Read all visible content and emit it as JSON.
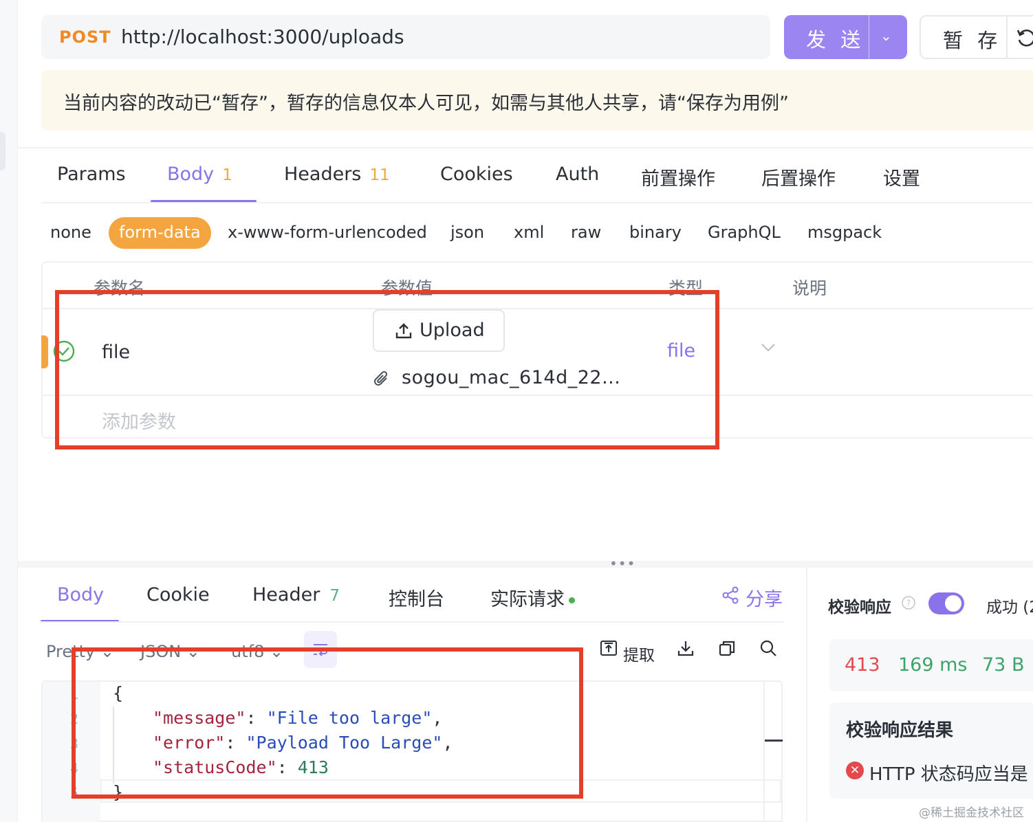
{
  "request": {
    "method": "POST",
    "url": "http://localhost:3000/uploads",
    "send_label": "发 送",
    "save_label": "暂 存"
  },
  "notice": "当前内容的改动已“暂存”，暂存的信息仅本人可见，如需与其他人共享，请“保存为用例”",
  "request_tabs": [
    {
      "label": "Params",
      "badge": ""
    },
    {
      "label": "Body",
      "badge": "1"
    },
    {
      "label": "Headers",
      "badge": "11"
    },
    {
      "label": "Cookies",
      "badge": ""
    },
    {
      "label": "Auth",
      "badge": ""
    },
    {
      "label": "前置操作",
      "badge": ""
    },
    {
      "label": "后置操作",
      "badge": ""
    },
    {
      "label": "设置",
      "badge": ""
    }
  ],
  "active_request_tab": "Body",
  "body_types": [
    "none",
    "form-data",
    "x-www-form-urlencoded",
    "json",
    "xml",
    "raw",
    "binary",
    "GraphQL",
    "msgpack"
  ],
  "active_body_type": "form-data",
  "params_table": {
    "headers": [
      "参数名",
      "参数值",
      "类型",
      "说明"
    ],
    "rows": [
      {
        "name": "file",
        "upload_label": "Upload",
        "filename": "sogou_mac_614d_22...",
        "type": "file"
      }
    ],
    "add_placeholder": "添加参数"
  },
  "response_tabs": [
    {
      "label": "Body",
      "badge": ""
    },
    {
      "label": "Cookie",
      "badge": ""
    },
    {
      "label": "Header",
      "badge": "7"
    },
    {
      "label": "控制台",
      "badge": ""
    },
    {
      "label": "实际请求",
      "badge": ""
    }
  ],
  "active_response_tab": "Body",
  "share_label": "分享",
  "format": {
    "view": "Pretty",
    "language": "JSON",
    "encoding": "utf8"
  },
  "extract_label": "提取",
  "response_body": {
    "line_numbers": [
      "1",
      "2",
      "3",
      "4",
      "5"
    ],
    "message_key": "\"message\"",
    "message_value": "\"File too large\"",
    "error_key": "\"error\"",
    "error_value": "\"Payload Too Large\"",
    "status_key": "\"statusCode\"",
    "status_value": "413"
  },
  "validation": {
    "title": "校验响应",
    "toggle_on": true,
    "status_text": "成功 (2",
    "status_code": "413",
    "time": "169 ms",
    "size": "73 B",
    "result_title": "校验响应结果",
    "result_text": "HTTP 状态码应当是"
  },
  "watermark": "@稀土掘金技术社区",
  "colors": {
    "accent": "#8a72ea",
    "orange": "#f4a540",
    "error": "#e5484d",
    "success": "#3ea36b",
    "annotation_red": "#e53e2a"
  }
}
